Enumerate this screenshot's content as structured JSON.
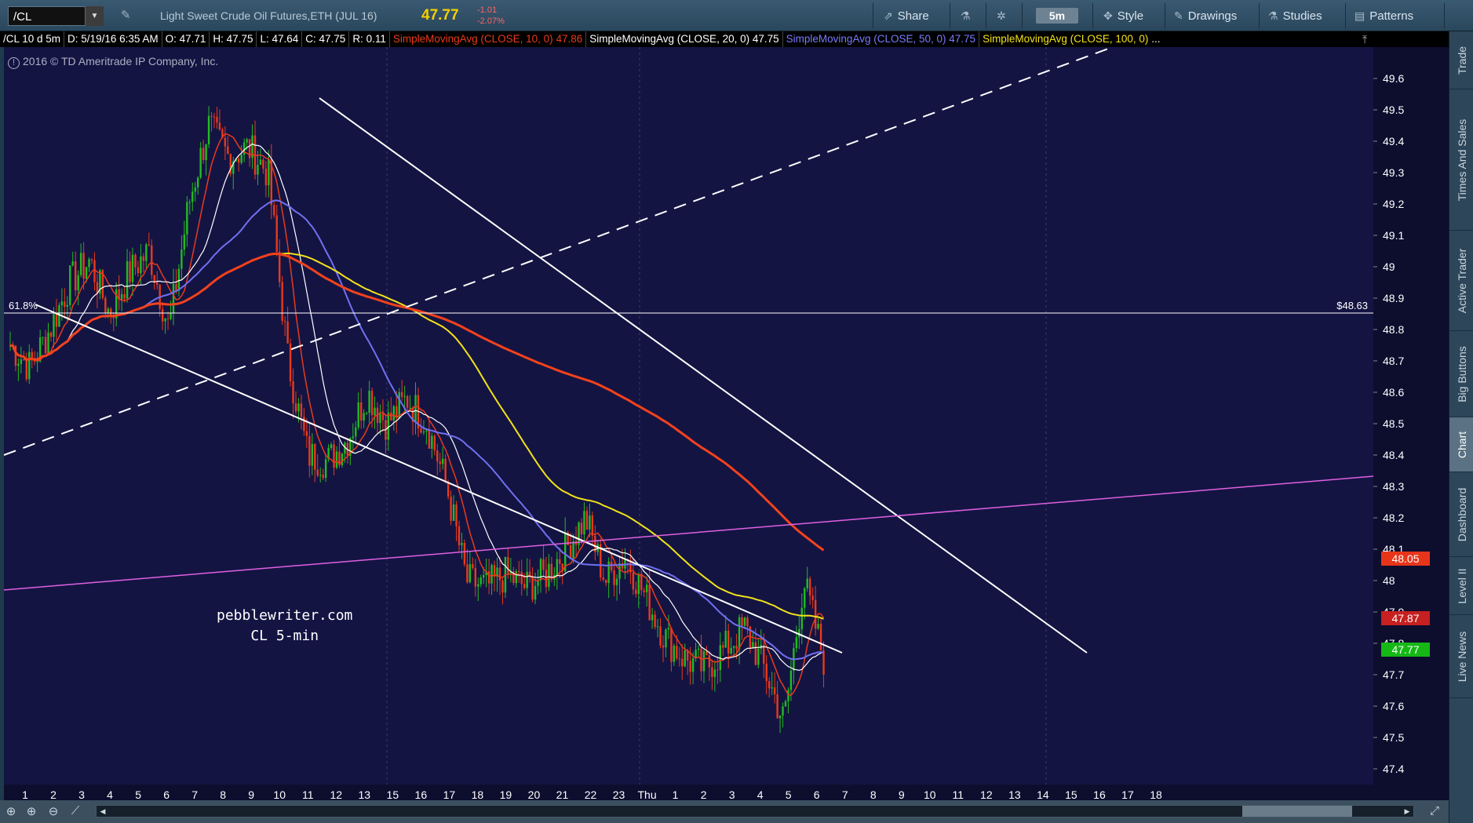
{
  "toolbar": {
    "symbol": "/CL",
    "title": "Light Sweet Crude Oil Futures,ETH (JUL 16)",
    "price": "47.77",
    "change": "-1.01",
    "change_pct": "-2.07%",
    "share_label": "Share",
    "timeframe": "5m",
    "style_label": "Style",
    "drawings_label": "Drawings",
    "studies_label": "Studies",
    "patterns_label": "Patterns"
  },
  "infobar": {
    "symbol": "/CL 10 d 5m",
    "date": "D: 5/19/16 6:35 AM",
    "open": "O: 47.71",
    "high": "H: 47.75",
    "low": "L: 47.64",
    "close": "C: 47.75",
    "range": "R: 0.11",
    "sma10": "SimpleMovingAvg (CLOSE, 10, 0)",
    "sma10_val": "47.86",
    "sma20": "SimpleMovingAvg (CLOSE, 20, 0)",
    "sma20_val": "47.75",
    "sma50": "SimpleMovingAvg (CLOSE, 50, 0)",
    "sma50_val": "47.75",
    "sma100": "SimpleMovingAvg (CLOSE, 100, 0)",
    "sma100_more": "..."
  },
  "chart": {
    "copyright": "2016 © TD Ameritrade IP Company, Inc.",
    "fib_label": "61.8%",
    "fib_price": "$48.63",
    "watermark_line1": "pebblewriter.com",
    "watermark_line2": "CL 5-min",
    "label_sma200": "48.05",
    "label_sma10": "47.87",
    "label_last": "47.77"
  },
  "colors": {
    "chart_bg": "#141443",
    "sma10": "#e83a1c",
    "sma20": "#ffffff",
    "sma50": "#7070f0",
    "sma100": "#f2e21a",
    "sma200": "#f2421c",
    "up_candle": "#22bb22",
    "down_candle": "#e83a1c",
    "trendline": "#ffffff",
    "magenta_line": "#e060e0"
  },
  "chart_data": {
    "type": "candlestick",
    "y_ticks": [
      "49.6",
      "49.5",
      "49.4",
      "49.3",
      "49.2",
      "49.1",
      "49",
      "48.9",
      "48.8",
      "48.7",
      "48.6",
      "48.5",
      "48.4",
      "48.3",
      "48.2",
      "48.1",
      "48",
      "47.9",
      "47.8",
      "47.7",
      "47.6",
      "47.5",
      "47.4"
    ],
    "x_ticks": [
      "1",
      "2",
      "3",
      "4",
      "5",
      "6",
      "7",
      "8",
      "9",
      "10",
      "11",
      "12",
      "13",
      "15",
      "16",
      "17",
      "18",
      "19",
      "20",
      "21",
      "22",
      "23",
      "Thu",
      "1",
      "2",
      "3",
      "4",
      "5",
      "6",
      "7",
      "8",
      "9",
      "10",
      "11",
      "12",
      "13",
      "14",
      "15",
      "16",
      "17",
      "18"
    ],
    "ylim": [
      47.35,
      49.7
    ],
    "close_path": [
      48.75,
      48.68,
      48.8,
      48.95,
      49.02,
      48.85,
      48.98,
      49.05,
      48.8,
      49.2,
      49.45,
      49.35,
      49.38,
      49.3,
      48.7,
      48.4,
      48.38,
      48.45,
      48.6,
      48.5,
      48.58,
      48.5,
      48.3,
      48.0,
      47.98,
      48.02,
      47.98,
      48.02,
      48.1,
      48.2,
      48.0,
      48.08,
      47.95,
      47.82,
      47.75,
      47.72,
      47.78,
      47.85,
      47.72,
      47.55,
      48.0,
      47.75
    ]
  },
  "sidebar": {
    "tabs": [
      "Trade",
      "Times And Sales",
      "Active Trader",
      "Big Buttons",
      "Chart",
      "Dashboard",
      "Level II",
      "Live News"
    ]
  }
}
